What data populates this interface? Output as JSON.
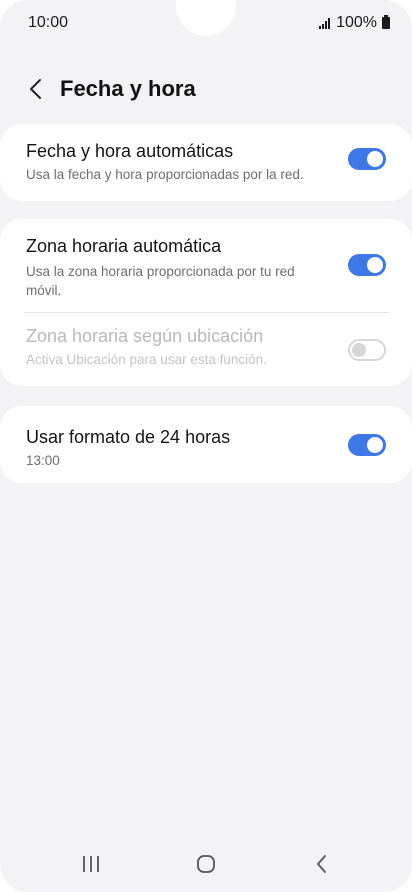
{
  "status_bar": {
    "time": "10:00",
    "battery": "100%"
  },
  "header": {
    "title": "Fecha y hora",
    "back_icon": "chevron-left-icon"
  },
  "settings": {
    "auto_datetime": {
      "title": "Fecha y hora automáticas",
      "subtitle": "Usa la fecha y hora proporcionadas por la red.",
      "enabled": true
    },
    "auto_timezone": {
      "title": "Zona horaria automática",
      "subtitle": "Usa la zona horaria proporcionada por tu red móvil.",
      "enabled": true
    },
    "location_timezone": {
      "title": "Zona horaria según ubicación",
      "subtitle": "Activa Ubicación para usar esta función.",
      "enabled": false
    },
    "format_24h": {
      "title": "Usar formato de 24 horas",
      "subtitle": "13:00",
      "enabled": true
    }
  },
  "colors": {
    "accent": "#3e78e6",
    "background": "#f3f3f5"
  },
  "nav": {
    "recents_icon": "recents-icon",
    "home_icon": "home-icon",
    "back_icon": "back-icon"
  }
}
